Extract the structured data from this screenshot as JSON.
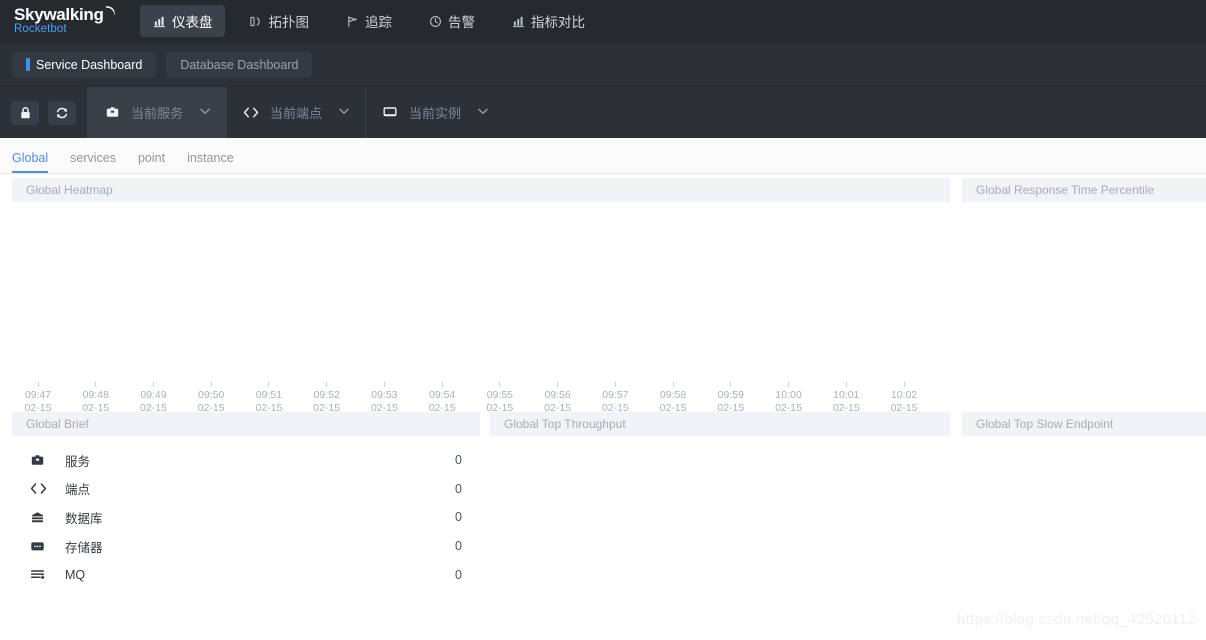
{
  "header": {
    "logo_main": "Skywalking",
    "logo_sub": "Rocketbot",
    "nav": [
      {
        "label": "仪表盘",
        "icon": "chart-bar-icon",
        "active": true
      },
      {
        "label": "拓扑图",
        "icon": "topology-icon",
        "active": false
      },
      {
        "label": "追踪",
        "icon": "trace-icon",
        "active": false
      },
      {
        "label": "告警",
        "icon": "alarm-clock-icon",
        "active": false
      },
      {
        "label": "指标对比",
        "icon": "compare-chart-icon",
        "active": false
      }
    ]
  },
  "dashboard_tabs": [
    {
      "label": "Service Dashboard",
      "active": true
    },
    {
      "label": "Database Dashboard",
      "active": false
    }
  ],
  "toolbar": {
    "lock_icon": "lock-icon",
    "refresh_icon": "refresh-icon",
    "selectors": [
      {
        "label": "当前服务",
        "icon": "service-icon",
        "caret": "⌄",
        "active": true
      },
      {
        "label": "当前端点",
        "icon": "endpoint-code-icon",
        "caret": "⌄",
        "active": false
      },
      {
        "label": "当前实例",
        "icon": "instance-monitor-icon",
        "caret": "⌄",
        "active": false
      }
    ]
  },
  "sub_tabs": [
    {
      "label": "Global",
      "active": true
    },
    {
      "label": "services",
      "active": false
    },
    {
      "label": "point",
      "active": false
    },
    {
      "label": "instance",
      "active": false
    }
  ],
  "panels": {
    "heatmap": {
      "title": "Global Heatmap"
    },
    "response_time_percentile": {
      "title": "Global Response Time Percentile"
    },
    "brief": {
      "title": "Global Brief"
    },
    "top_throughput": {
      "title": "Global Top Throughput"
    },
    "top_slow_endpoint": {
      "title": "Global Top Slow Endpoint"
    }
  },
  "chart_data": {
    "type": "heatmap",
    "title": "Global Heatmap",
    "xlabel": "",
    "ylabel": "",
    "grid": false,
    "legend": "none",
    "date": "02-15",
    "x_ticks": [
      "09:47",
      "09:48",
      "09:49",
      "09:50",
      "09:51",
      "09:52",
      "09:53",
      "09:54",
      "09:55",
      "09:56",
      "09:57",
      "09:58",
      "09:59",
      "10:00",
      "10:01",
      "10:02"
    ],
    "x_tick_dates": [
      "02-15",
      "02-15",
      "02-15",
      "02-15",
      "02-15",
      "02-15",
      "02-15",
      "02-15",
      "02-15",
      "02-15",
      "02-15",
      "02-15",
      "02-15",
      "02-15",
      "02-15",
      "02-15"
    ],
    "values": [],
    "note": "no data rendered in heatmap area"
  },
  "brief_items": [
    {
      "icon": "service-icon",
      "label": "服务",
      "value": "0"
    },
    {
      "icon": "endpoint-code-icon",
      "label": "端点",
      "value": "0"
    },
    {
      "icon": "database-icon",
      "label": "数据库",
      "value": "0"
    },
    {
      "icon": "storage-icon",
      "label": "存储器",
      "value": "0"
    },
    {
      "icon": "mq-icon",
      "label": "MQ",
      "value": "0"
    }
  ],
  "watermark": "https://blog.csdn.net/qq_42520112",
  "colors": {
    "nav_bg": "#252a2f",
    "bar_bg": "#2c3138",
    "accent_blue": "#4b8df8",
    "panel_head_bg": "#f2f3f7",
    "panel_head_text": "#a6abb8"
  }
}
